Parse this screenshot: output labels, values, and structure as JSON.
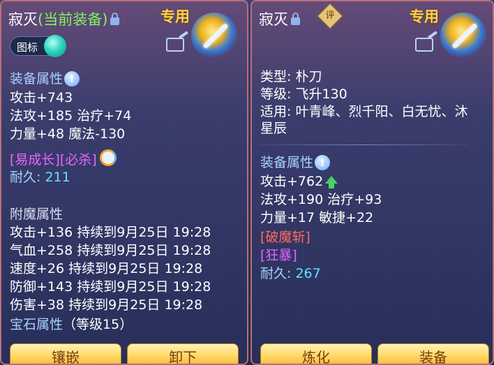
{
  "left": {
    "title": "寂灭",
    "equipped": "(当前装备)",
    "special": "专用",
    "toggle_label": "图标",
    "attr_header": "装备属性",
    "attrs": [
      "攻击+743",
      "法攻+185 治疗+74",
      "力量+48 魔法-130"
    ],
    "tags": "[易成长][必杀]",
    "durability_label": "耐久: ",
    "durability": "211",
    "enchant_header": "附魔属性",
    "enchants": [
      "攻击+136 持续到9月25日 19:28",
      "气血+258 持续到9月25日 19:28",
      "速度+26 持续到9月25日 19:28",
      "防御+143 持续到9月25日 19:28",
      "伤害+38 持续到9月25日 19:28"
    ],
    "gem_header": "宝石属性",
    "gem_level": "（等级15）",
    "btn_inlay": "镶嵌",
    "btn_remove": "卸下"
  },
  "right": {
    "title": "寂灭",
    "eval_badge": "评",
    "special": "专用",
    "type_line": "类型: 朴刀",
    "level_line": "等级: 飞升130",
    "fit_line1": "适用: 叶青峰、烈千阳、白无忧、沐",
    "fit_line2": "星辰",
    "attr_header": "装备属性",
    "attrs": [
      "攻击+762",
      "法攻+190 治疗+93",
      "力量+17 敏捷+22"
    ],
    "tag_red": "[破魔斩]",
    "tag_pink": "[狂暴]",
    "durability_label": "耐久: ",
    "durability": "267",
    "btn_refine": "炼化",
    "btn_equip": "装备"
  },
  "colors": {
    "accent_gold": "#ffd24a",
    "equipped_green": "#7bf55c",
    "section_blue": "#a8d2ff",
    "value_cyan": "#5fe4ff",
    "tag_pink": "#e766ff",
    "tag_red": "#ff6a5a"
  },
  "icons": [
    "lock-icon",
    "info-icon",
    "refresh-icon",
    "share-icon",
    "weapon-icon",
    "up-arrow-icon",
    "eval-badge-icon"
  ]
}
